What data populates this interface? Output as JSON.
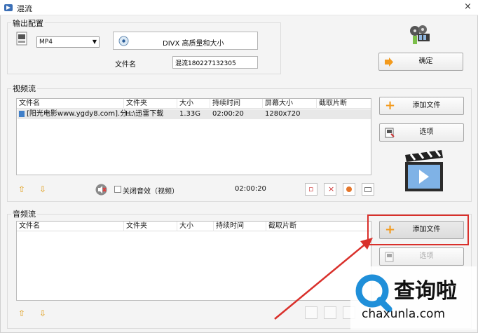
{
  "window": {
    "title": "混流",
    "close": "×"
  },
  "output": {
    "label": "输出配置",
    "format": "MP4",
    "codec": "DIVX 高质量和大小",
    "filename_label": "文件名",
    "filename_value": "混流180227132305",
    "ok_button": "确定"
  },
  "video": {
    "label": "视频流",
    "columns": [
      "文件名",
      "文件夹",
      "大小",
      "持续时间",
      "屏幕大小",
      "截取片断"
    ],
    "rows": [
      {
        "name": "[阳光电影www.ygdy8.com].分...",
        "folder": "H:\\迅雷下载",
        "size": "1.33G",
        "duration": "02:00:20",
        "screen": "1280x720",
        "clip": ""
      }
    ],
    "add_button": "添加文件",
    "options_button": "选项",
    "mute_label": "关闭音效（视频）",
    "total_duration": "02:00:20"
  },
  "audio": {
    "label": "音频流",
    "columns": [
      "文件名",
      "文件夹",
      "大小",
      "持续时间",
      "截取片断"
    ],
    "add_button": "添加文件",
    "options_button": "选项"
  },
  "watermark": {
    "brand": "查询啦",
    "domain": "chaxunla.com"
  },
  "colors": {
    "highlight_box": "#d9302b",
    "plus_icon": "#f39a1c",
    "brand_blue": "#1f8fd9"
  }
}
